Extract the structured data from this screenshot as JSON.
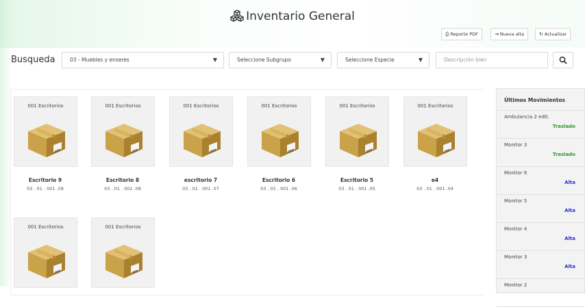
{
  "page": {
    "title": "Inventario General",
    "title_icon": "cubes-icon"
  },
  "toolbar": {
    "report_label": "Reporte PDF",
    "report_icon": "print-icon",
    "new_label": "Nueva alta",
    "new_icon": "sign-in-icon",
    "refresh_label": "Actualizar",
    "refresh_icon": "refresh-icon"
  },
  "search": {
    "label": "Busqueda",
    "group_value": "03 - Muebles y enseres",
    "subgroup_value": "Seleccione Subgrupo",
    "species_value": "Seleccione Especie",
    "description_placeholder": "Descripción bien",
    "search_icon": "search-icon"
  },
  "items": [
    {
      "category": "001 Escritorios",
      "name": "Escritorio 9",
      "code": "03 . 01 . 001 .09"
    },
    {
      "category": "001 Escritorios",
      "name": "Escritorio 8",
      "code": "03 . 01 . 001 .08"
    },
    {
      "category": "001 Escritorios",
      "name": "escritorio 7",
      "code": "03 . 01 . 001 .07"
    },
    {
      "category": "001 Escritorios",
      "name": "Escritorio 6",
      "code": "03 . 01 . 001 .06"
    },
    {
      "category": "001 Escritorios",
      "name": "Escritorio 5",
      "code": "03 . 01 . 001 .05"
    },
    {
      "category": "001 Escritorios",
      "name": "e4",
      "code": "03 . 01 . 001 .04"
    },
    {
      "category": "001 Escritorios"
    },
    {
      "category": "001 Escritorios"
    }
  ],
  "movements": {
    "title": "Últimos Movimientos",
    "entries": [
      {
        "name": "Ambulancia 2 edit.",
        "type": "Traslado"
      },
      {
        "name": "Monitor 3",
        "type": "Traslado"
      },
      {
        "name": "Monitor 6",
        "type": "Alta"
      },
      {
        "name": "Monitor 5",
        "type": "Alta"
      },
      {
        "name": "Monitor 4",
        "type": "Alta"
      },
      {
        "name": "Monitor 3",
        "type": "Alta"
      },
      {
        "name": "Monitor 2"
      }
    ]
  },
  "colors": {
    "traslado": "#2e9a2e",
    "alta": "#2b2bd6",
    "box": "#c9a24a"
  }
}
